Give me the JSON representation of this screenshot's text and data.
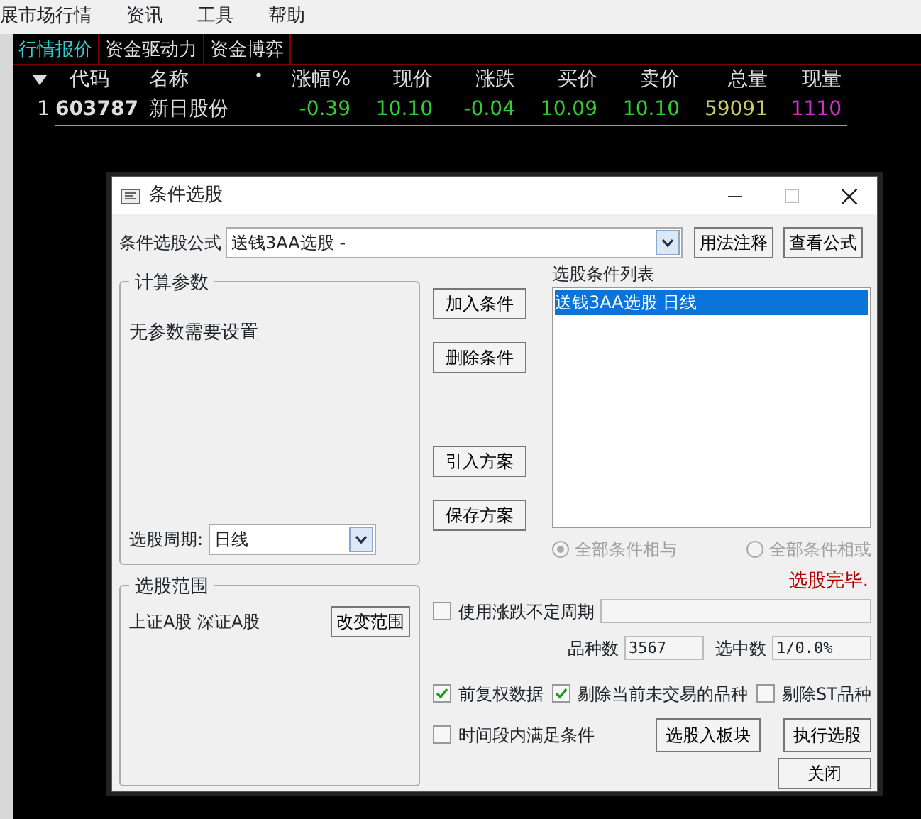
{
  "menu": [
    {
      "label": "展市场行情"
    },
    {
      "label": "资讯"
    },
    {
      "label": "工具"
    },
    {
      "label": "帮助"
    }
  ],
  "tabs": [
    {
      "label": "行情报价",
      "selected": true
    },
    {
      "label": "资金驱动力",
      "selected": false
    },
    {
      "label": "资金博弈",
      "selected": false
    }
  ],
  "quote_table": {
    "columns": [
      {
        "label": "代码",
        "kind": "code"
      },
      {
        "label": "名称",
        "kind": "name"
      },
      {
        "label": "•",
        "kind": "marker"
      },
      {
        "label": "涨幅%",
        "kind": "num"
      },
      {
        "label": "现价",
        "kind": "num"
      },
      {
        "label": "涨跌",
        "kind": "num"
      },
      {
        "label": "买价",
        "kind": "num"
      },
      {
        "label": "卖价",
        "kind": "num"
      },
      {
        "label": "总量",
        "kind": "num"
      },
      {
        "label": "现量",
        "kind": "num"
      }
    ],
    "rows": [
      {
        "index": "1",
        "cells": [
          {
            "text": "603787"
          },
          {
            "text": "新日股份"
          },
          {
            "text": ""
          },
          {
            "text": "-0.39",
            "color": "#33cc33"
          },
          {
            "text": "10.10",
            "color": "#33cc33"
          },
          {
            "text": "-0.04",
            "color": "#33cc33"
          },
          {
            "text": "10.09",
            "color": "#33cc33"
          },
          {
            "text": "10.10",
            "color": "#33cc33"
          },
          {
            "text": "59091",
            "color": "#cccc66"
          },
          {
            "text": "1110",
            "color": "#cc33cc"
          }
        ]
      }
    ]
  },
  "dialog": {
    "title": "条件选股",
    "formula_label": "条件选股公式",
    "formula_value": "送钱3AA选股  -",
    "top_buttons": [
      "用法注释",
      "查看公式"
    ],
    "params_group": {
      "title": "计算参数",
      "message": "无参数需要设置",
      "period_label": "选股周期:",
      "period_value": "日线"
    },
    "scope_group": {
      "title": "选股范围",
      "markets": "上证A股  深证A股",
      "button": "改变范围"
    },
    "action_buttons": [
      "加入条件",
      "删除条件",
      "引入方案",
      "保存方案"
    ],
    "condition_list": {
      "label": "选股条件列表",
      "items": [
        {
          "text": "送钱3AA选股   日线",
          "selected": true
        }
      ]
    },
    "radios": [
      {
        "label": "全部条件相与",
        "selected": true,
        "disabled": true
      },
      {
        "label": "全部条件相或",
        "selected": false,
        "disabled": true
      }
    ],
    "status": "选股完毕.",
    "variable_period": {
      "label": "使用涨跌不定周期",
      "checked": false
    },
    "counts": [
      {
        "label": "品种数",
        "value": "3567"
      },
      {
        "label": "选中数",
        "value": "1/0.0%"
      }
    ],
    "options": [
      {
        "label": "前复权数据",
        "checked": true
      },
      {
        "label": "剔除当前未交易的品种",
        "checked": true
      },
      {
        "label": "剔除ST品种",
        "checked": false
      }
    ],
    "time_option": {
      "label": "时间段内满足条件",
      "checked": false
    },
    "bottom_buttons": [
      "选股入板块",
      "执行选股"
    ],
    "close_button": "关闭"
  }
}
